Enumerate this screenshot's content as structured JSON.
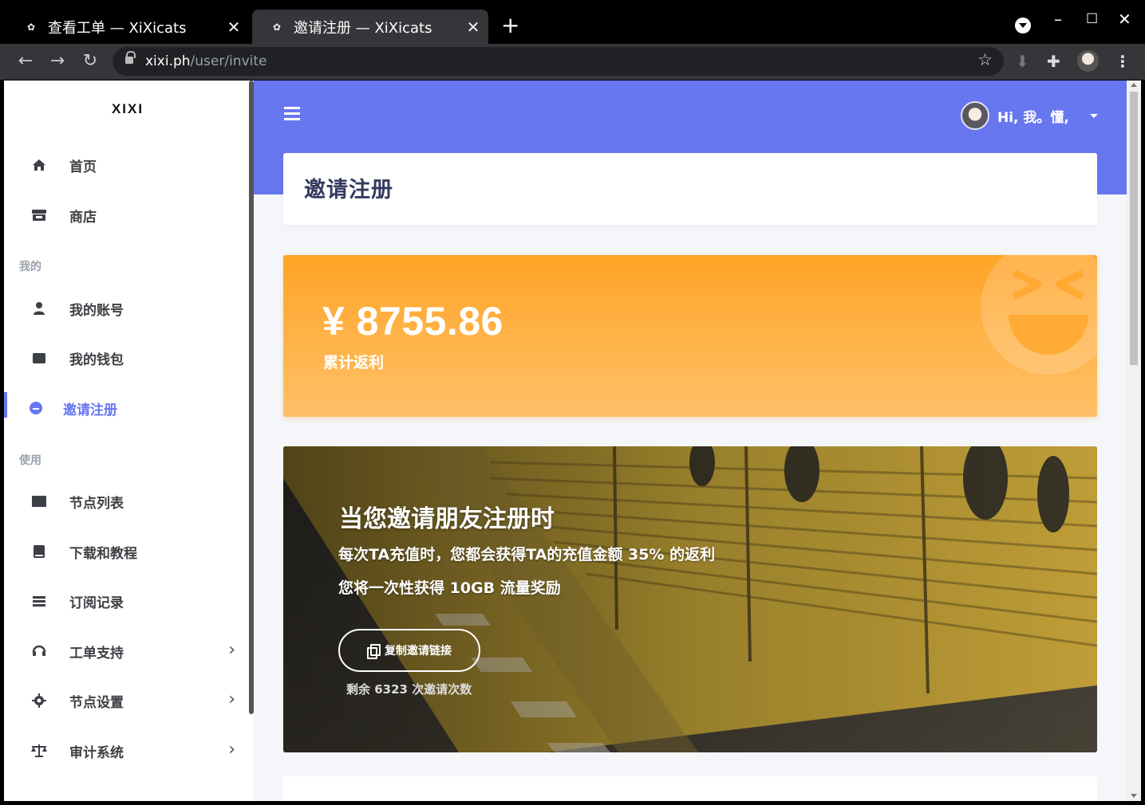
{
  "browser": {
    "tabs": [
      {
        "title": "查看工单 — XiXicats",
        "active": false
      },
      {
        "title": "邀请注册 — XiXicats",
        "active": true
      }
    ],
    "new_tab_label": "+",
    "url_host": "xixi.ph",
    "url_path": "/user/invite",
    "window_controls": {
      "minimize": "–",
      "maximize": "☐",
      "close": "✕"
    }
  },
  "sidebar": {
    "brand": "XIXI",
    "items": [
      {
        "label": "首页",
        "icon": "home-icon"
      },
      {
        "label": "商店",
        "icon": "store-icon"
      }
    ],
    "section_mine": "我的",
    "mine_items": [
      {
        "label": "我的账号",
        "icon": "user-icon"
      },
      {
        "label": "我的钱包",
        "icon": "wallet-icon"
      },
      {
        "label": "邀请注册",
        "icon": "smile-icon",
        "active": true
      }
    ],
    "section_use": "使用",
    "use_items": [
      {
        "label": "节点列表",
        "icon": "server-icon"
      },
      {
        "label": "下载和教程",
        "icon": "book-icon"
      },
      {
        "label": "订阅记录",
        "icon": "list-icon"
      },
      {
        "label": "工单支持",
        "icon": "headset-icon",
        "chevron": "›"
      },
      {
        "label": "节点设置",
        "icon": "cog-icon",
        "chevron": "›"
      },
      {
        "label": "审计系统",
        "icon": "balance-scale-icon",
        "chevron": "›"
      }
    ]
  },
  "header": {
    "greeting": "Hi, 我。懂,"
  },
  "page_title": "邀请注册",
  "rebate": {
    "amount": "¥ 8755.86",
    "label": "累计返利"
  },
  "invite": {
    "title": "当您邀请朋友注册时",
    "line1": "每次TA充值时，您都会获得TA的充值金额 35% 的返利",
    "line2": "您将一次性获得 10GB 流量奖励",
    "copy_button": "复制邀请链接",
    "remaining": "剩余 6323 次邀请次数"
  },
  "colors": {
    "primary": "#6777ef",
    "warning": "#ffa426",
    "page_bg": "#f4f6f9",
    "chrome_dark": "#35363a"
  }
}
